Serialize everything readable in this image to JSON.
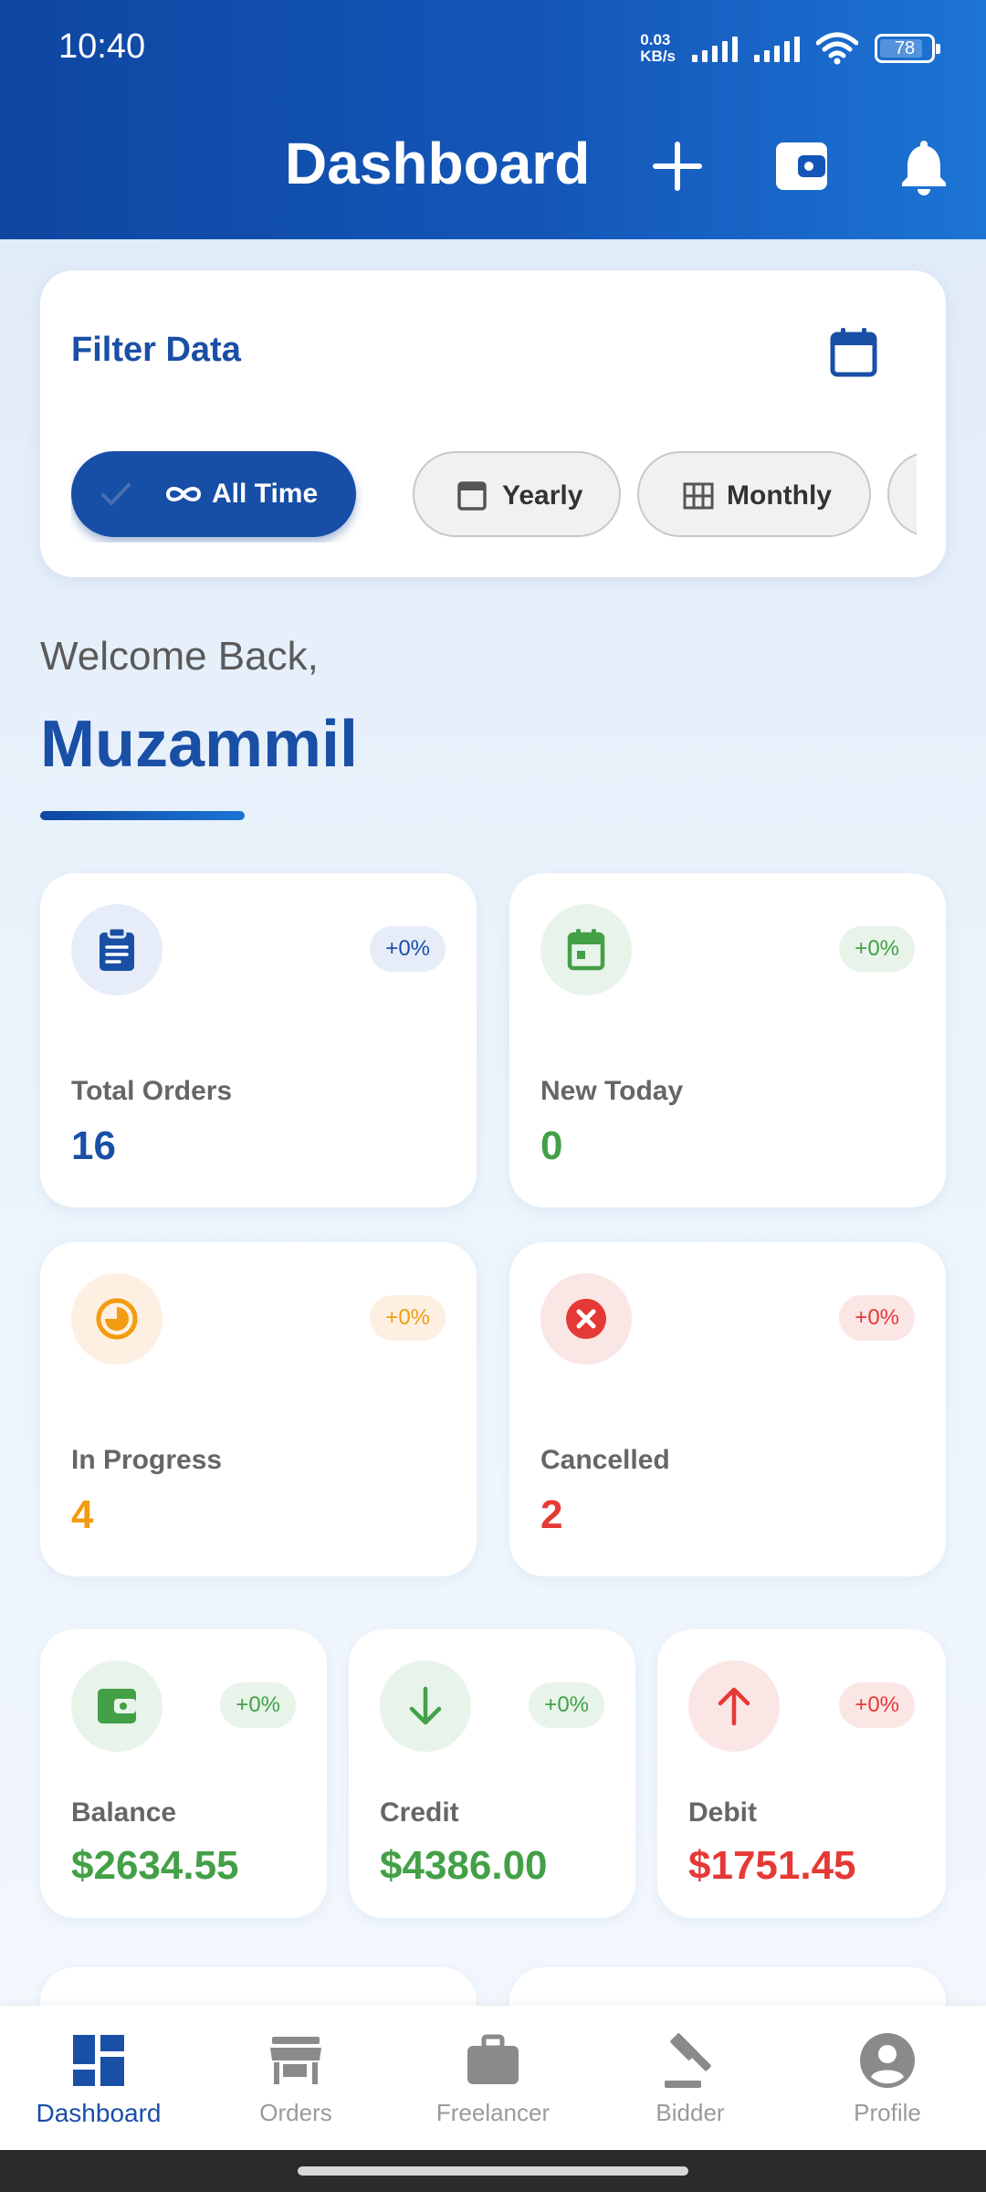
{
  "status_bar": {
    "time": "10:40",
    "net_speed_value": "0.03",
    "net_speed_unit": "KB/s",
    "battery": "78"
  },
  "header": {
    "title": "Dashboard",
    "icons": [
      "add-icon",
      "wallet-icon",
      "bell-icon"
    ]
  },
  "filter": {
    "title": "Filter Data",
    "chips": [
      {
        "label": "All Time",
        "icon": "infinity-icon",
        "selected": true
      },
      {
        "label": "Yearly",
        "icon": "calendar-icon",
        "selected": false
      },
      {
        "label": "Monthly",
        "icon": "grid-icon",
        "selected": false
      }
    ]
  },
  "welcome": {
    "greeting": "Welcome Back,",
    "name": "Muzammil"
  },
  "stats": [
    {
      "label": "Total Orders",
      "value": "16",
      "badge": "+0%",
      "icon": "clipboard-icon",
      "color": "#1a4fa6"
    },
    {
      "label": "New Today",
      "value": "0",
      "badge": "+0%",
      "icon": "calendar-icon",
      "color": "#43a047"
    },
    {
      "label": "In Progress",
      "value": "4",
      "badge": "+0%",
      "icon": "progress-clock-icon",
      "color": "#f39c12"
    },
    {
      "label": "Cancelled",
      "value": "2",
      "badge": "+0%",
      "icon": "cancel-icon",
      "color": "#e53935"
    }
  ],
  "finance": [
    {
      "label": "Balance",
      "value": "$2634.55",
      "badge": "+0%",
      "icon": "wallet-icon",
      "color": "#43a047"
    },
    {
      "label": "Credit",
      "value": "$4386.00",
      "badge": "+0%",
      "icon": "arrow-down-icon",
      "color": "#43a047"
    },
    {
      "label": "Debit",
      "value": "$1751.45",
      "badge": "+0%",
      "icon": "arrow-up-icon",
      "color": "#e53935"
    }
  ],
  "bottom_nav": [
    {
      "label": "Dashboard",
      "icon": "dashboard-icon",
      "active": true
    },
    {
      "label": "Orders",
      "icon": "store-icon",
      "active": false
    },
    {
      "label": "Freelancer",
      "icon": "briefcase-icon",
      "active": false
    },
    {
      "label": "Bidder",
      "icon": "gavel-icon",
      "active": false
    },
    {
      "label": "Profile",
      "icon": "profile-icon",
      "active": false
    }
  ]
}
